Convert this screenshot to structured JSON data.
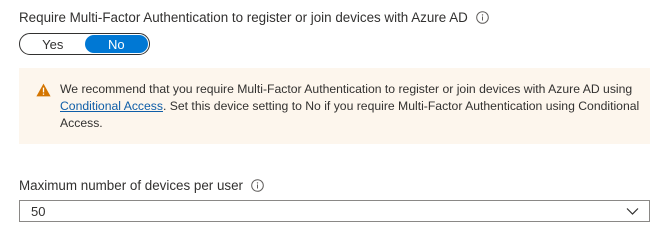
{
  "mfa_setting": {
    "label": "Require Multi-Factor Authentication to register or join devices with Azure AD",
    "info_icon": "info-icon",
    "toggle": {
      "options": [
        "Yes",
        "No"
      ],
      "selected": "No"
    }
  },
  "warning": {
    "icon": "warning-icon",
    "text_before_link": "We recommend that you require Multi-Factor Authentication to register or join devices with Azure AD using ",
    "link_text": "Conditional Access",
    "text_after_link": ". Set this device setting to No if you require Multi-Factor Authentication using Conditional Access.",
    "background_color": "#fdf6ed",
    "icon_color": "#d47500"
  },
  "max_devices": {
    "label": "Maximum number of devices per user",
    "info_icon": "info-icon",
    "selected_value": "50",
    "dropdown_icon": "chevron-down-icon"
  },
  "colors": {
    "accent": "#0078d4",
    "link": "#0f5ea8",
    "text": "#323130"
  }
}
